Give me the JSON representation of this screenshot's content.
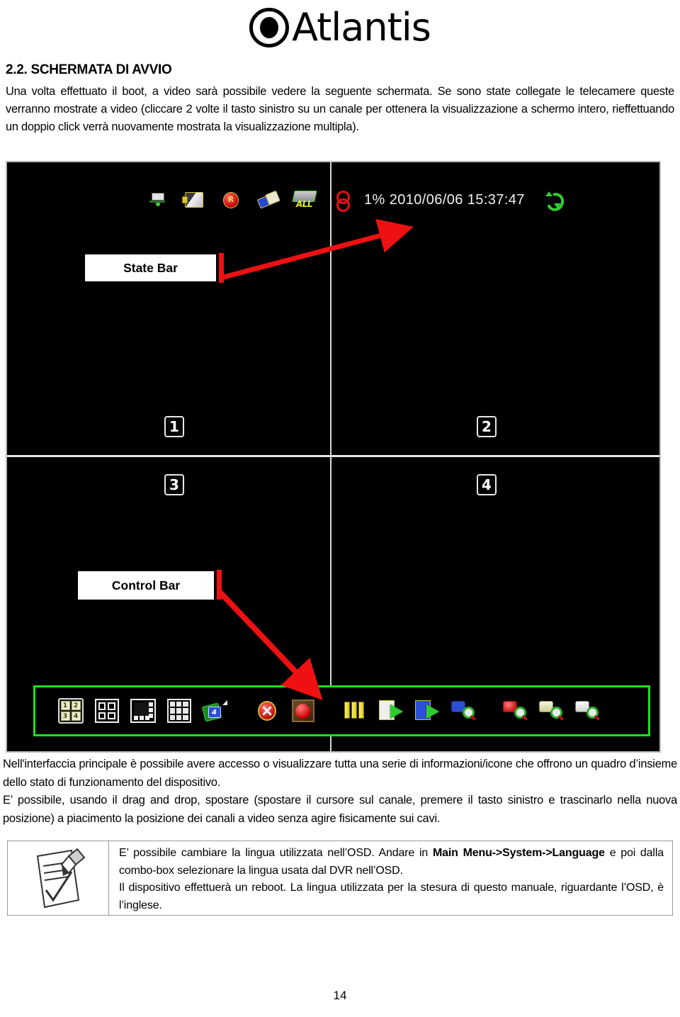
{
  "brand": {
    "name": "Atlantis",
    "logo_icon": "atlantis-circle-logo"
  },
  "heading": "2.2. SCHERMATA DI AVVIO",
  "intro_paragraph": "Una volta effettuato il boot, a video sarà possibile vedere la seguente schermata. Se sono state collegate le telecamere queste verranno mostrate a video (cliccare 2 volte il tasto sinistro su un canale per ottenera la visualizzazione a schermo intero, rieffettuando un doppio click verrà nuovamente mostrata la visualizzazione multipla).",
  "dvr": {
    "status_bar": {
      "icons": [
        {
          "name": "network-status-icon",
          "title": "network"
        },
        {
          "name": "hdd-icon",
          "title": "hard disk"
        },
        {
          "name": "record-status-icon",
          "title": "recording"
        },
        {
          "name": "usb-device-icon",
          "title": "usb"
        },
        {
          "name": "hdd-all-icon",
          "title": "ALL",
          "label": "ALL"
        },
        {
          "name": "link-chain-icon",
          "title": "link"
        }
      ],
      "percent": "1%",
      "datetime": "2010/06/06 15:37:47",
      "cycle_icon": "rotate-cycle-icon"
    },
    "channels": [
      {
        "label": "1"
      },
      {
        "label": "2"
      },
      {
        "label": "3"
      },
      {
        "label": "4"
      }
    ],
    "callouts": {
      "state_bar": "State Bar",
      "control_bar": "Control Bar"
    },
    "control_bar": {
      "buttons": [
        {
          "name": "layout-quad-numbered-button",
          "label_1": "1",
          "label_2": "2",
          "label_3": "3",
          "label_4": "4"
        },
        {
          "name": "layout-quad-button"
        },
        {
          "name": "layout-one-plus-seven-button"
        },
        {
          "name": "layout-nine-split-button"
        },
        {
          "name": "channel-swap-button",
          "badge": "4"
        },
        {
          "name": "stop-record-button"
        },
        {
          "name": "record-button"
        },
        {
          "name": "archive-books-button"
        },
        {
          "name": "playback-button"
        },
        {
          "name": "playback-reverse-button"
        },
        {
          "name": "search-playlist-button"
        },
        {
          "name": "search-alarm-button"
        },
        {
          "name": "search-backup-button"
        },
        {
          "name": "search-log-button"
        }
      ],
      "border_color": "#19e219"
    }
  },
  "body_paragraphs": [
    "Nell'interfaccia principale è possibile avere accesso o visualizzare  tutta una serie di informazioni/icone che offrono un quadro d’insieme dello stato di funzionamento del dispositivo.",
    "E’ possibile, usando il drag and drop, spostare (spostare il cursore sul canale, premere il tasto sinistro e trascinarlo nella nuova posizione) a piacimento la posizione dei canali a video senza agire fisicamente sui cavi."
  ],
  "note": {
    "icon": "notepad-pencil-icon",
    "line1_pre": "E’ possibile cambiare la lingua utilizzata nell’OSD. Andare in ",
    "line1_bold": "Main Menu->System->Language",
    "line1_post": " e poi dalla combo-box selezionare la lingua usata dal DVR nell’OSD.",
    "line2": "Il dispositivo effettuerà un reboot. La lingua utilizzata per la stesura di questo manuale, riguardante l’OSD, è l’inglese."
  },
  "page_number": "14"
}
